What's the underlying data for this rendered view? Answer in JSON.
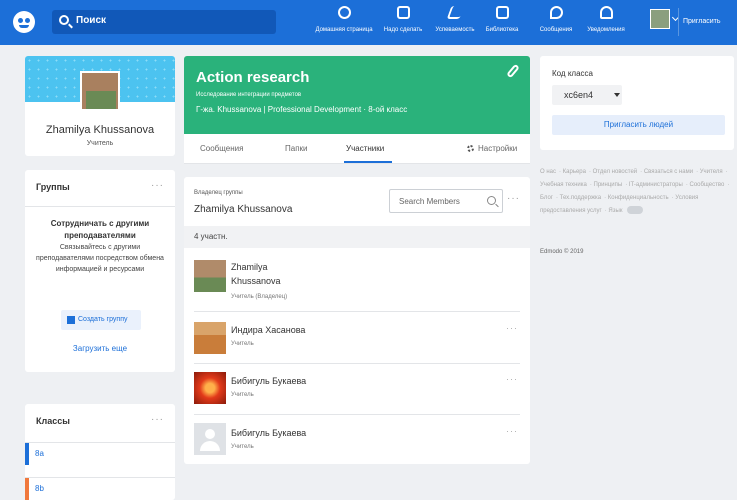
{
  "topbar": {
    "search_placeholder": "Поиск",
    "nav": [
      {
        "label": "Домашняя страница",
        "icon": "home-icon"
      },
      {
        "label": "Надо сделать",
        "icon": "todo-icon"
      },
      {
        "label": "Успеваемость",
        "icon": "progress-icon"
      },
      {
        "label": "Библиотека",
        "icon": "library-icon"
      },
      {
        "label": "Сообщения",
        "icon": "messages-icon"
      },
      {
        "label": "Уведомления",
        "icon": "notifications-icon"
      }
    ],
    "invite_label": "Пригласить",
    "accent": "#1c6fd8"
  },
  "profile": {
    "name": "Zhamilya Khussanova",
    "role": "Учитель"
  },
  "groups_card": {
    "title": "Группы",
    "more": "···",
    "heading": "Сотрудничать с другими преподавателями",
    "text": "Связывайтесь с другими преподавателями посредством обмена информацией и ресурсами",
    "create_button": "Создать группу",
    "load_more": "Загрузить еще"
  },
  "classes_card": {
    "title": "Классы",
    "more": "···",
    "items": [
      {
        "label": "8а",
        "color": "#1c6fd8"
      },
      {
        "label": "8b",
        "color": "#f0783c"
      }
    ]
  },
  "group": {
    "title": "Action research",
    "subtitle": "Исследование интеграции предметов",
    "meta": "Г-жа. Khussanova | Professional Development · 8-ой класс",
    "color": "#2ab27b",
    "tabs": [
      "Сообщения",
      "Папки",
      "Участники"
    ],
    "active_tab": "Участники",
    "settings_label": "Настройки"
  },
  "members": {
    "owner_label": "Владелец группы",
    "owner_name": "Zhamilya Khussanova",
    "search_placeholder": "Search Members",
    "more": "···",
    "count": "4 участн.",
    "list": [
      {
        "name_line1": "Zhamilya",
        "name_line2": "Khussanova",
        "role": "Учитель (Владелец)"
      },
      {
        "name": "Индира Хасанова",
        "role": "Учитель",
        "more": "···"
      },
      {
        "name": "Бибигуль Букаева",
        "role": "Учитель",
        "more": "···"
      },
      {
        "name": "Бибигуль Букаева",
        "role": "Учитель",
        "more": "···"
      }
    ]
  },
  "class_code": {
    "label": "Код класса",
    "value": "xc6en4",
    "invite_button": "Пригласить людей"
  },
  "footer": {
    "links": [
      "О нас",
      "Карьера",
      "Отдел новостей",
      "Связаться с нами",
      "Учителя",
      "Учебная техника",
      "Принципы",
      "IT-администраторы",
      "Сообщество",
      "Блог",
      "Тех.поддержка",
      "Конфиденциальность",
      "Условия предоставления услуг",
      "Язык"
    ],
    "copyright": "Edmodo © 2019"
  }
}
